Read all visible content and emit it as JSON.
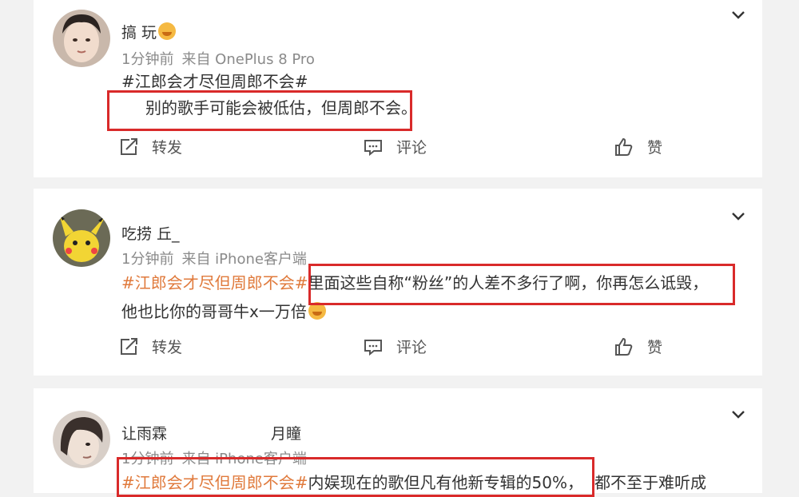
{
  "posts": [
    {
      "username": "搞      玩",
      "time": "1分钟前",
      "source": "来自 OnePlus 8 Pro",
      "topic": "#江郎会才尽但周郎不会#",
      "text_line1": "别的歌手可能会被低估，但周郎不会。",
      "text_line2": "",
      "actions": {
        "repost": "转发",
        "comment": "评论",
        "like": "赞"
      }
    },
    {
      "username": "吃捞        丘_",
      "time": "1分钟前",
      "source": "来自 iPhone客户端",
      "topic": "#江郎会才尽但周郎不会#",
      "text_line1": "里面这些自称“粉丝”的人差不多行了啊，你再怎么诋毁，",
      "text_line2": "他也比你的哥哥牛x一万倍",
      "actions": {
        "repost": "转发",
        "comment": "评论",
        "like": "赞"
      }
    },
    {
      "username": "让雨霖",
      "username2": "月瞳",
      "time": "1分钟前",
      "source": "来自 iPhone客户端",
      "topic": "#江郎会才尽但周郎不会#",
      "text_line1": "内娱现在的歌但凡有他新专辑的50%，",
      "text_tail": "都不至于难听成"
    }
  ],
  "colors": {
    "highlight_box": "#d92a2a",
    "topic": "#e07a3c",
    "meta": "#8a8a8a"
  },
  "icons": [
    "chevron-down-icon",
    "repost-icon",
    "comment-icon",
    "like-icon"
  ]
}
